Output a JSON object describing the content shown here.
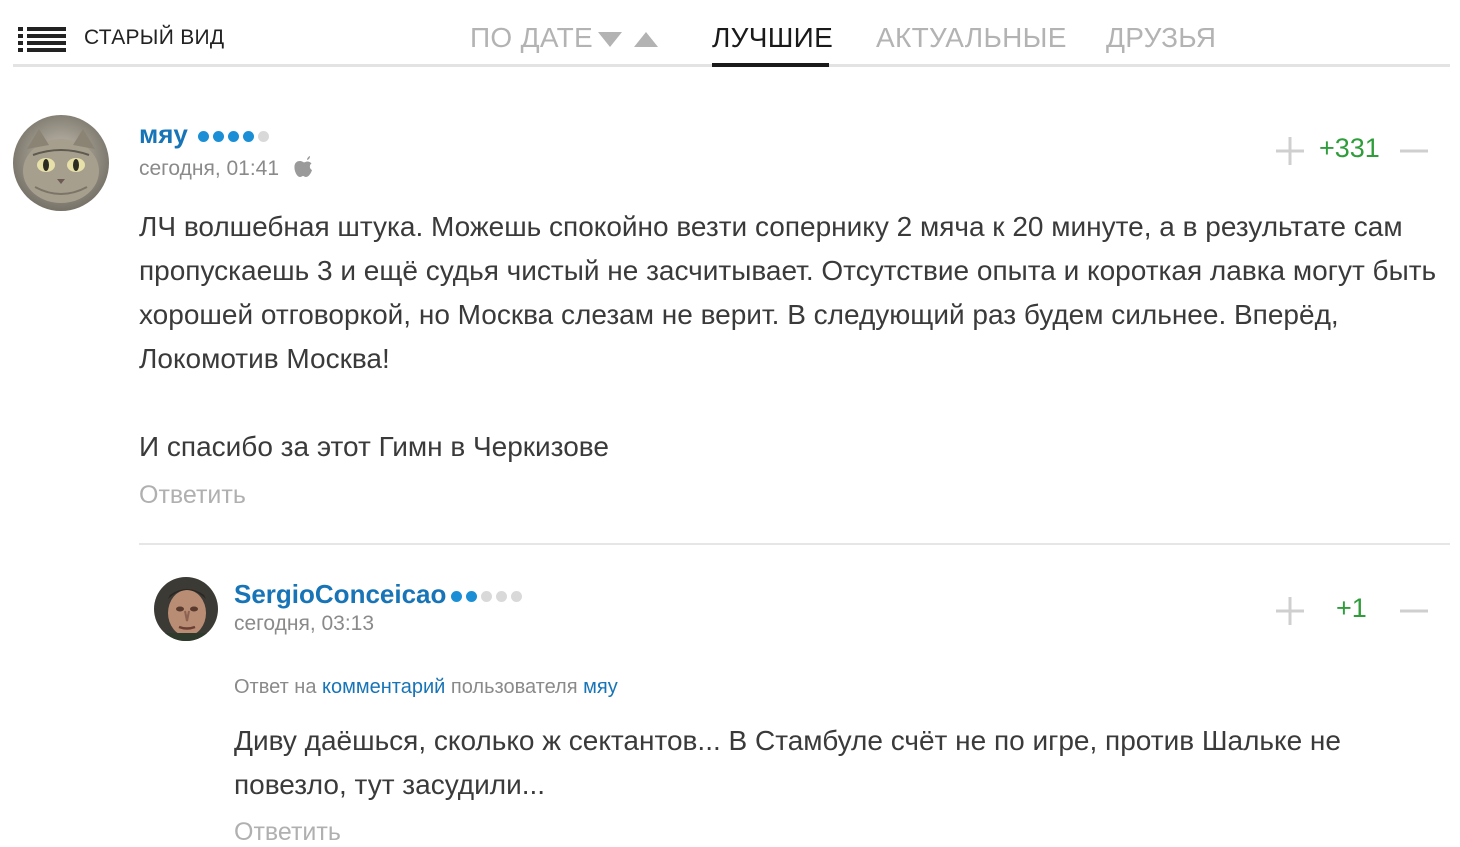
{
  "toolbar": {
    "old_view_label": "СТАРЫЙ ВИД",
    "tabs": [
      {
        "label": "ПО ДАТЕ",
        "active": false
      },
      {
        "label": "ЛУЧШИЕ",
        "active": true
      },
      {
        "label": "АКТУАЛЬНЫЕ",
        "active": false
      },
      {
        "label": "ДРУЗЬЯ",
        "active": false
      }
    ],
    "icons": {
      "menu": "list-menu-icon",
      "sort_desc": "triangle-down-icon",
      "sort_asc": "triangle-up-icon"
    }
  },
  "comments": [
    {
      "author": "мяу",
      "rating_level": 4,
      "rating_max": 5,
      "time": "сегодня, 01:41",
      "device_icon": "apple-icon",
      "score": "+331",
      "paragraphs": [
        "ЛЧ волшебная штука. Можешь спокойно везти сопернику 2 мяча к 20 минуте, а в результате сам пропускаешь 3 и ещё судья чистый не засчитывает. Отсутствие опыта и короткая лавка могут быть хорошей отговоркой, но Москва слезам не верит. В следующий раз будем сильнее. Вперёд, Локомотив Москва!",
        "И спасибо за этот Гимн в Черкизове"
      ],
      "reply_label": "Ответить"
    },
    {
      "author": "SergioConceicao",
      "rating_level": 2,
      "rating_max": 5,
      "time": "сегодня, 03:13",
      "score": "+1",
      "reply_to": {
        "prefix": "Ответ на",
        "link_text": "комментарий",
        "middle": "пользователя",
        "user": "мяу"
      },
      "paragraphs": [
        "Диву даёшься, сколько ж сектантов... В Стамбуле счёт не по игре, против Шальке не повезло, тут засудили..."
      ],
      "reply_label": "Ответить"
    }
  ],
  "colors": {
    "accent_blue": "#1774b6",
    "score_green": "#2e9d3a",
    "muted_gray": "#b0b0b0",
    "dot_active": "#1a8fd6",
    "dot_inactive": "#d9d9d9"
  }
}
